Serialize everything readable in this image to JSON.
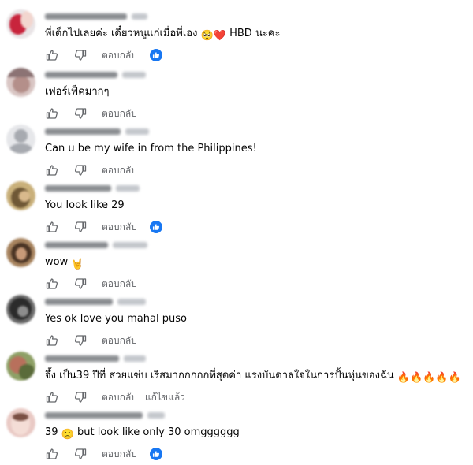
{
  "actions": {
    "reply_label": "ตอบกลับ",
    "edit_label": "แก้ไขแล้ว"
  },
  "icons": {
    "like": "thumbs-up-icon",
    "dislike": "thumbs-down-icon",
    "reaction": "like-reaction-icon"
  },
  "colors": {
    "reaction_blue": "#1877f2",
    "muted_text": "#65676b"
  },
  "comments": [
    {
      "text_before": "พี่เด็กไปเลยค่ะ เดี๋ยวหนูแก่เมื่อพี่เอง ",
      "emoji": "🥺❤️",
      "text_after": " HBD นะคะ",
      "has_reaction": true
    },
    {
      "text": "เฟอร์เฟ็คมากๆ",
      "has_reaction": false
    },
    {
      "text": "Can u be my wife in from the Philippines!",
      "has_reaction": false
    },
    {
      "text": "You look like 29",
      "has_reaction": true
    },
    {
      "text_before": "wow ",
      "emoji": "🤘",
      "text_after": "",
      "has_reaction": false
    },
    {
      "text": "Yes ok love you mahal puso",
      "has_reaction": false
    },
    {
      "text_before": "จึ้ง เป็น39 ปีที่ สวยแซ่บ เริสมากกกกกที่สุดค่า แรงบันดาลใจในการปั้นหุ่นของฉัน ",
      "emoji": "🔥🔥🔥🔥🔥",
      "text_after": "",
      "has_reaction": false,
      "edited": true
    },
    {
      "text_before": "39 ",
      "emoji": "🙁",
      "text_after": " but look like only 30 omgggggg",
      "has_reaction": true
    }
  ]
}
